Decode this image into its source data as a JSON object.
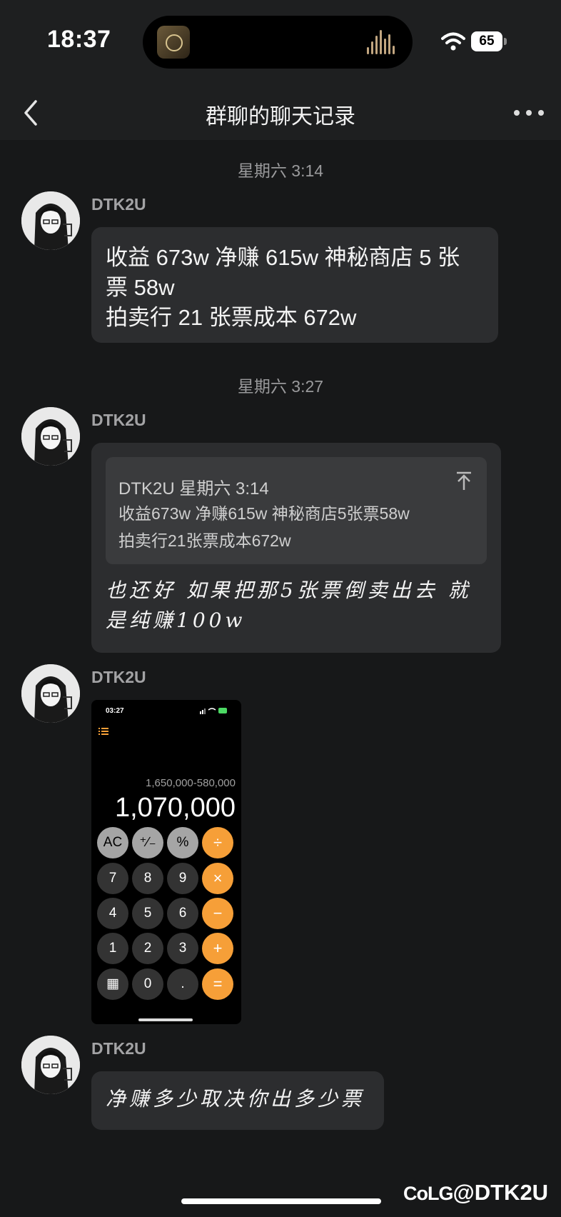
{
  "status_bar": {
    "time": "18:37",
    "battery": "65"
  },
  "nav": {
    "title": "群聊的聊天记录"
  },
  "messages": [
    {
      "timestamp": "星期六 3:14",
      "sender": "DTK2U",
      "lines": [
        "收益 673w 净赚 615w 神秘商店 5 张",
        "票 58w",
        "拍卖行 21 张票成本 672w"
      ]
    },
    {
      "timestamp": "星期六 3:27",
      "sender": "DTK2U",
      "quote": {
        "header": "DTK2U 星期六 3:14",
        "line1": "收益673w 净赚615w 神秘商店5张票58w",
        "line2": "拍卖行21张票成本672w"
      },
      "lines": [
        "也还好 如果把那5张票倒卖出去 就",
        "是纯赚100w"
      ]
    },
    {
      "sender": "DTK2U",
      "image": {
        "time": "03:27",
        "expression": "1,650,000-580,000",
        "result": "1,070,000",
        "keys": [
          [
            "AC",
            "⁺∕₋",
            "%",
            "÷"
          ],
          [
            "7",
            "8",
            "9",
            "×"
          ],
          [
            "4",
            "5",
            "6",
            "−"
          ],
          [
            "1",
            "2",
            "3",
            "+"
          ],
          [
            "▦",
            "0",
            ".",
            "="
          ]
        ]
      }
    },
    {
      "sender": "DTK2U",
      "lines": [
        "净赚多少取决你出多少票"
      ]
    }
  ],
  "watermark": {
    "logo": "CoLG",
    "handle": "@DTK2U"
  },
  "colors": {
    "background": "#171819",
    "bubble": "#2c2d2f",
    "calc_operator": "#f69f38"
  }
}
